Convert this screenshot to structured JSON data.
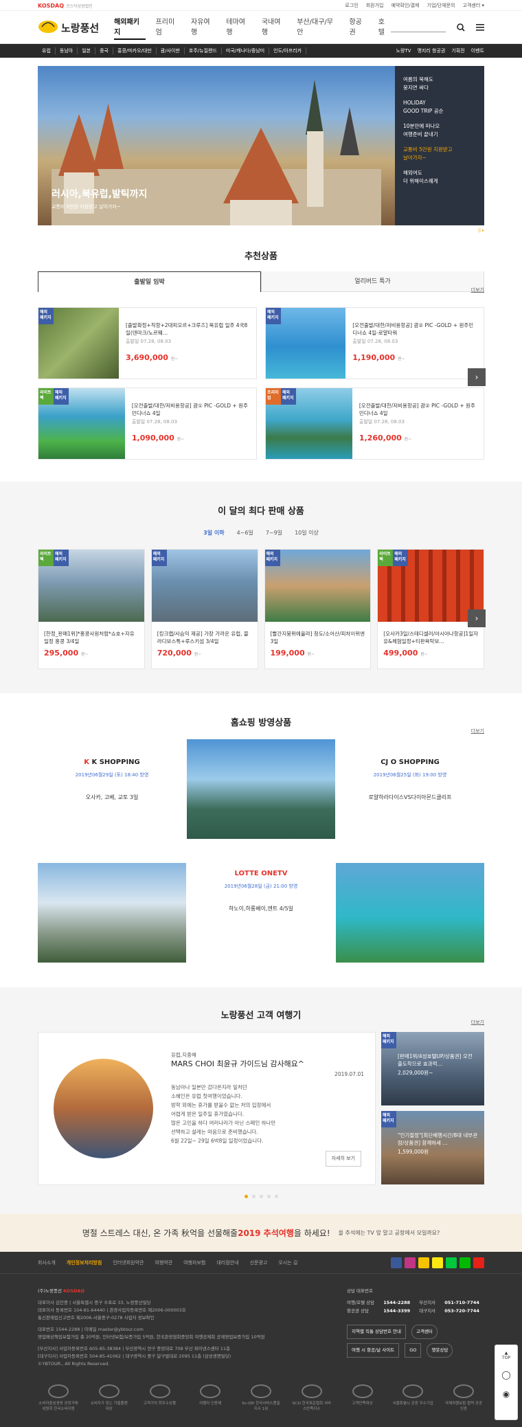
{
  "topbar": {
    "brand": "KOSDAQ",
    "brand_sub": "코스닥상장법인",
    "links": [
      "로그인",
      "회원가입",
      "예약확인/결제",
      "기업/단체문의",
      "고객센터 ▾"
    ]
  },
  "gnb": {
    "logo": "노랑풍선",
    "menu": [
      "해외패키지",
      "프리미엄",
      "자유여행",
      "테마여행",
      "국내여행",
      "부산/대구/무안",
      "항공권",
      "호텔"
    ]
  },
  "catbar": {
    "left": [
      "유럽",
      "동남아",
      "일본",
      "중국",
      "홍콩/마카오/대만",
      "괌/사이판",
      "호주/뉴질랜드",
      "미국/캐나다/중남미",
      "인도/아프리카"
    ],
    "right": [
      "노랑TV",
      "맹지리 항공권",
      "기획전",
      "이벤트"
    ]
  },
  "hero": {
    "title": "러시아,북유럽,발틱까지",
    "subtitle": "교통비 5만원 지원받고 날아가자~",
    "side": [
      "여름의 북해도\n뭉지면 싸다",
      "HOLIDAY\nGOOD TRIP 공순",
      "10분만에 떠나오\n여행준비 끝내기",
      "교통비 5만원 지원받고\n날아가자~",
      "해외여도\n더 위해이스퀘게"
    ],
    "indicator": "||  ▸"
  },
  "recommend": {
    "title": "추천상품",
    "tabs": [
      "출발일 임박",
      "얼리버드 특가"
    ],
    "more": "더보기",
    "items": [
      {
        "badges": [
          "해외\n패키지"
        ],
        "name": "[출발확정+직항+2대피오르+크루즈] 북유럽 일주 4국8일(덴마크/노르웨…",
        "dep_label": "출발일",
        "dep": "07.28, 08.03",
        "price": "3,690,000",
        "won": "원~"
      },
      {
        "badges": [
          "해외\n패키지"
        ],
        "name": "[오전출발/대한/저비용항공] 괌② PIC -GOLD + 원주민디너쇼 4일-로얄타워",
        "dep_label": "출발일",
        "dep": "07.28, 08.03",
        "price": "1,190,000",
        "won": "원~"
      },
      {
        "badges": [
          "라이트팩",
          "해외\n패키지"
        ],
        "name": "[오전출발/대한/저비용항공] 괌① PIC -GOLD + 원주민디너쇼 4일",
        "dep_label": "출발일",
        "dep": "07.28, 08.03",
        "price": "1,090,000",
        "won": "원~"
      },
      {
        "badges": [
          "프리미엄",
          "해외\n패키지"
        ],
        "name": "[오전출발/대한/저비용항공] 괌② PIC -GOLD + 원주민디너쇼 4일",
        "dep_label": "출발일",
        "dep": "07.28, 08.03",
        "price": "1,260,000",
        "won": "원~"
      }
    ]
  },
  "best": {
    "title": "이 달의 최다 판매 상품",
    "tabs": [
      "3일 이하",
      "4~6일",
      "7~9일",
      "10일 이상"
    ],
    "items": [
      {
        "badges": [
          "라이트팩",
          "해외\n패키지"
        ],
        "name": "[한정_판매1위]*홍콩사원처럼*쇼호+자유일정 홍콩 3/4일",
        "price": "295,000",
        "won": "원~"
      },
      {
        "badges": [
          "해외\n패키지"
        ],
        "name": "[킹크랩/사슴익 제공] 가장 가까운 유럽, 블라디보스톡+루스키섬 3/4일",
        "price": "720,000",
        "won": "원~"
      },
      {
        "badges": [
          "해외\n패키지"
        ],
        "name": "[빨간지붕위에올라] 청도/소어산/피차이위엔 3일",
        "price": "199,000",
        "won": "원~"
      },
      {
        "badges": [
          "라이트팩",
          "해외\n패키지"
        ],
        "name": "[오사카3일/스테디셀러/아시아나항공]1일자유&체험일정+티판욕탁보…",
        "price": "499,000",
        "won": "원~"
      }
    ]
  },
  "homeshop": {
    "title": "홈쇼핑 방영상품",
    "more": "더보기",
    "items": [
      {
        "logo": "K SHOPPING",
        "date": "2019년06월29일 (토) 18:40 방영",
        "name": "오사카, 고베, 교토 3일"
      },
      {
        "logo": "CJ O SHOPPING",
        "date": "2019년06월25일 (화) 19:00 방영",
        "name": "로얄하라다이스VS다이아몬드클리프"
      },
      {
        "logo": "LOTTE ONETV",
        "date": "2019년06월28일 (금) 21:00 방영",
        "name": "하노이,하롱베이,엔트 4/5일"
      }
    ]
  },
  "review": {
    "title": "노랑풍선 고객 여행기",
    "more": "더보기",
    "tag": "유럽,지중해",
    "headline": "MARS CHOI 최윤규 가이드님 감사해요^",
    "date": "2019.07.01",
    "body": "동남아나 일본만 갔다온지라 잎처던\n소혜인은 유럽 첫여행이었습니다.\n방학 외에는 휴가를 받을수 없는 처의 입장에서\n어렵게 받은 일주일 휴가였습니다.\n많은 고민을 하다 여러나라가 아닌 스페인 하나만\n선택하고 설레는 마음으로 준비했습니다.\n6월 22일~ 29일 6박8일 일정이었습니다.",
    "btn": "자세히 보기",
    "side": [
      {
        "badge": "해외\n패키지",
        "text": "[판매1위/4성호텔UP/상품권] 오전 출도착으로 효과적…",
        "price": "2,029,000원~"
      },
      {
        "badge": "해외\n패키지",
        "text": "\"인기절정\"[최단배행시간/8대 내부관람/상품권] 함께하세 …",
        "price": "1,599,000원"
      }
    ]
  },
  "banner": {
    "pre": "명절 스트레스 대신, 온 가족 秋억을 선물해줄 ",
    "hl": "2019 추석여행",
    "post": "을 하세요!",
    "sub": "올 추석에는 TV 앞 말고 공항에서 모일까요?"
  },
  "footer": {
    "nav": [
      "회사소개",
      "개인정보처리방침",
      "인터넷회원약관",
      "여행약관",
      "여행자보험",
      "대리점안내",
      "신문광고",
      "오시는 길"
    ],
    "company": "(주)노랑풍선",
    "lines": [
      "대표이사 김인중 | 서울특별시 중구 수표로 33, 노랑풍선빌딩",
      "대표이사 등록번호 104-81-64440 | 관광사업자등록번호 제2006-000003호",
      "통신판매업신고번호 제2006-서울중구-0278  사업자 정보확인",
      "대표번호 1544-2288 | 이메일 master@ybtour.com",
      "영업배상책임보험가입 총 20억원, 인터넷보험/보증가입 5억원, 한국관광협회중앙회 여행공제회 공제영업보증가입 10억원",
      "[부산지사] 사업자등록번호 605-85-38384 | 부산광역시 연구 중앙대로 708 부산 파이낸스센터 11층",
      "[대구지사] 사업자등록번호 504-85-41062 | 대구광역시 중구 달구벌대로 2095 11층 (삼성생명빌딩)",
      "©YBTOUR., All Rights Reserved."
    ],
    "cs_title": "상담 대표번호",
    "cs": [
      [
        "여행/호텔 상담",
        "1544-2288"
      ],
      [
        "항공권 상담",
        "1544-3399"
      ],
      [
        "부산지사",
        "051-710-7744"
      ],
      [
        "대구지사",
        "053-720-7744"
      ]
    ],
    "btns": [
      "지역별 직통 상담번호 안내",
      "고객센터",
      "여행 시 항공/날 사이트",
      "GO",
      "챗봇상담"
    ],
    "certs": [
      "소비자중심경영 공정거래위원회 한국소비자원",
      "소비자가 믿는 가을플랜 대상",
      "고객가치 최우수상품",
      "여행자 인증제",
      "Ks-QEI 한국서비스품질지수 1위",
      "SCSI 한국표준협회 서비스만족지수",
      "고객만족대상",
      "서울특별시 관광 우수기업",
      "국제여행보험 협력 공공 인증"
    ]
  },
  "float": {
    "top": "TOP"
  },
  "colors": {
    "accent": "#e4322b",
    "brand_yellow": "#f0a500",
    "dark": "#2a2a2a",
    "blue": "#3f6dd0"
  }
}
